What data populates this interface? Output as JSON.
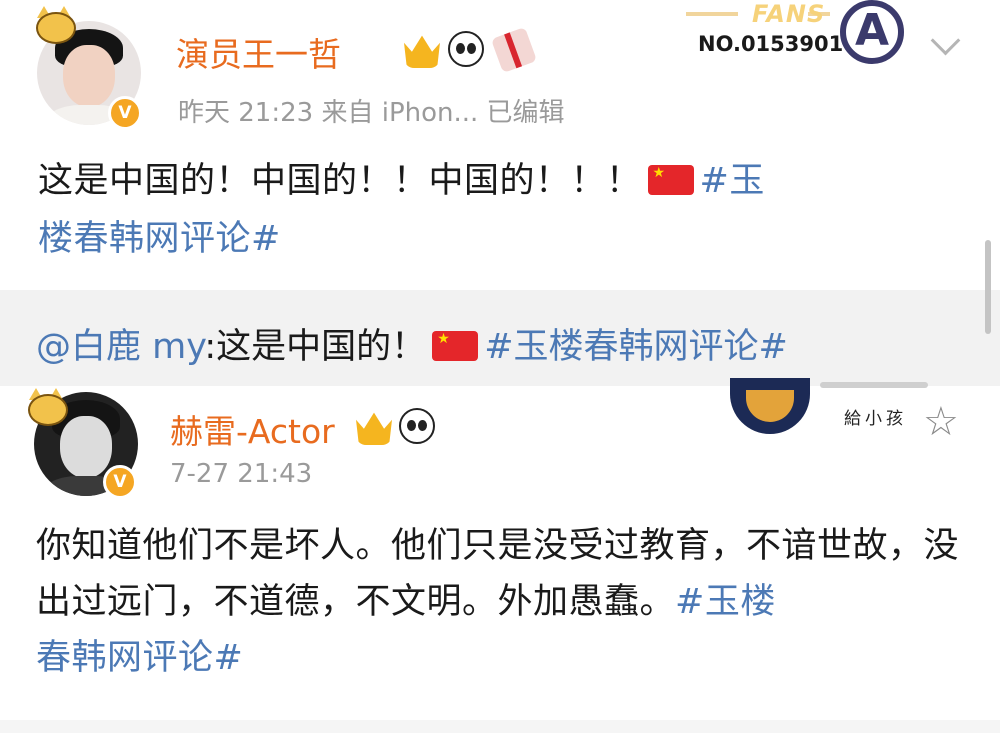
{
  "post1": {
    "username": "演员王一哲",
    "meta": "昨天 21:23  来自 iPhon...  已编辑",
    "text_plain": "这是中国的！中国的！！中国的！！！",
    "hashtag_part1": "#玉",
    "hashtag_part2": "楼春韩网评论#",
    "repost": {
      "mention": "@白鹿 my",
      "text": ":这是中国的！",
      "hashtag": "#玉楼春韩网评论#"
    },
    "fans_card": {
      "label": "FANS",
      "number": "NO.0153901",
      "logo_letter": "A"
    },
    "verified_badge": "V",
    "icons": [
      "crown-icon",
      "panda-icon",
      "gift-icon",
      "flag-icon",
      "chevron-down-icon"
    ]
  },
  "post2": {
    "username": "赫雷-Actor",
    "meta": "7-27 21:43",
    "text_plain": "你知道他们不是坏人。他们只是没受过教育，不谙世故，没出过远门，不道德，不文明。外加愚蠢。",
    "hashtag_part1": "#玉楼",
    "hashtag_part2": "春韩网评论#",
    "deco_text": "給小孩",
    "verified_badge": "V",
    "icons": [
      "crown-icon",
      "panda-icon",
      "star-icon"
    ]
  },
  "colors": {
    "username": "#e86b1f",
    "hashtag": "#4c79b5",
    "meta": "#9a9a9a",
    "verified": "#f5a623",
    "repost_bg": "#f2f2f2"
  }
}
